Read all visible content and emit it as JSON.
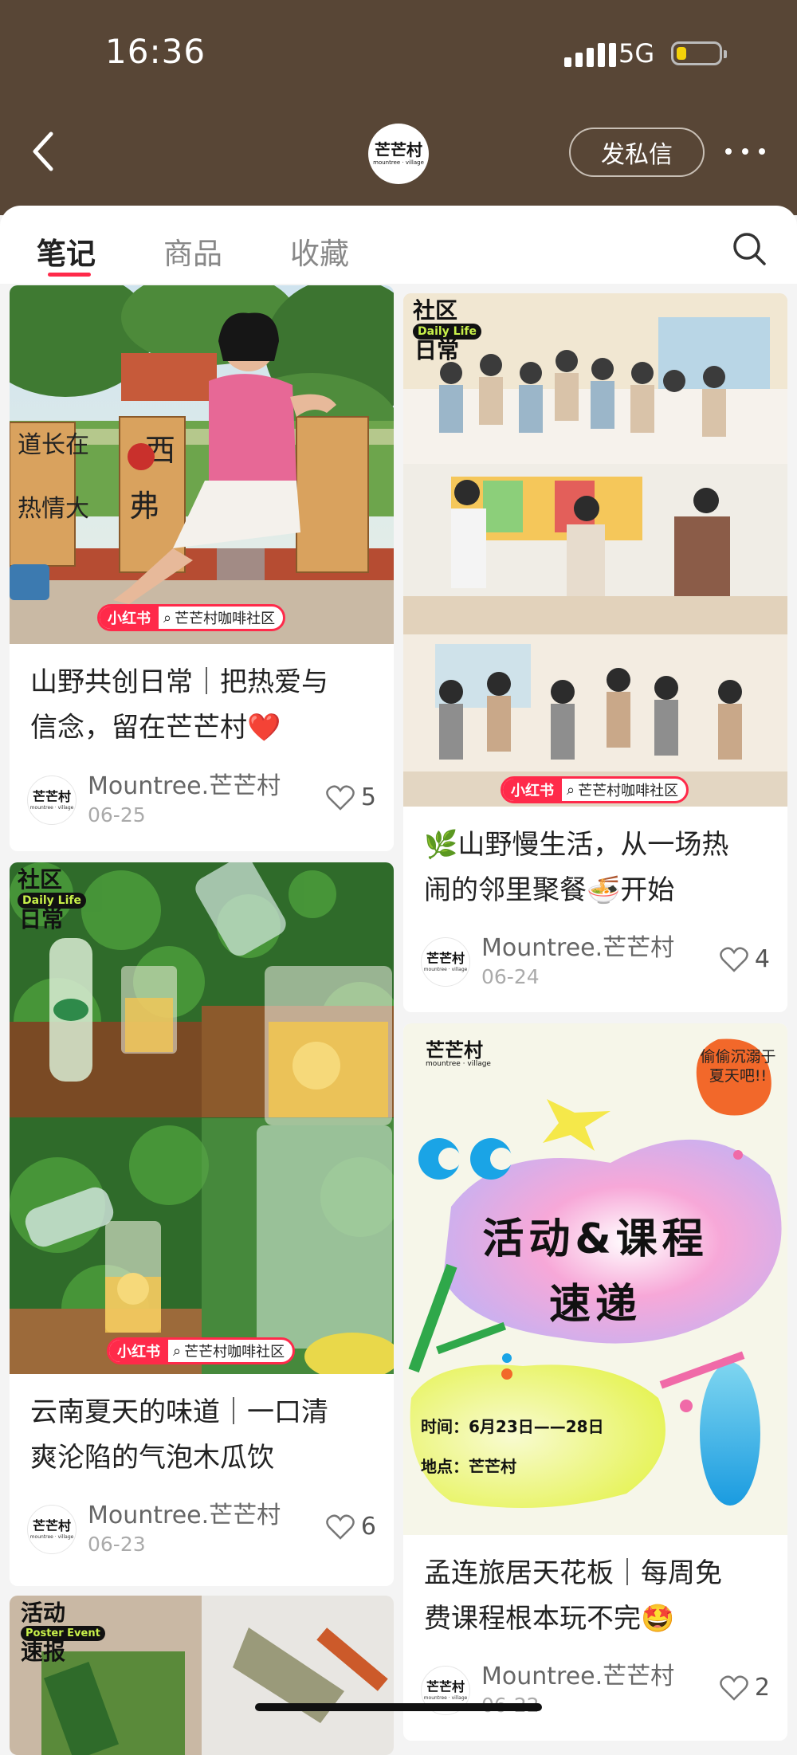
{
  "status": {
    "time": "16:36",
    "network": "5G"
  },
  "header": {
    "logo_title": "芒芒村",
    "logo_sub": "mountree · village",
    "dm_label": "发私信"
  },
  "tabs": [
    {
      "label": "笔记",
      "active": true
    },
    {
      "label": "商品",
      "active": false
    },
    {
      "label": "收藏",
      "active": false
    }
  ],
  "badge": {
    "red": "小红书",
    "search": "芒芒村咖啡社区"
  },
  "notes": [
    {
      "title_line1": "山野共创日常｜把热爱与",
      "title_line2": "信念，留在芒芒村❤️",
      "author": "Mountree.芒芒村",
      "date": "06-25",
      "likes": "5"
    },
    {
      "title_line1": "🌿山野慢生活，从一场热",
      "title_line2": "闹的邻里聚餐🍜开始",
      "author": "Mountree.芒芒村",
      "date": "06-24",
      "likes": "4"
    },
    {
      "title_line1": "云南夏天的味道｜一口清",
      "title_line2": "爽沦陷的气泡木瓜饮",
      "author": "Mountree.芒芒村",
      "date": "06-23",
      "likes": "6"
    },
    {
      "title_line1": "孟连旅居天花板｜每周免",
      "title_line2": "费课程根本玩不完🤩",
      "author": "Mountree.芒芒村",
      "date": "06-22",
      "likes": "2"
    }
  ],
  "poster_texts": {
    "community_top": "社区",
    "community_daily": "Daily Life",
    "community_cn": "日常",
    "activity_top": "活动",
    "activity_en": "Poster Event",
    "activity_cn": "速报",
    "corner_badge": "偷偷沉溺于夏天吧!!",
    "headline_1": "活动&课程",
    "headline_2": "速递",
    "time": "时间：6月23日——28日",
    "place": "地点：芒芒村",
    "brand": "芒芒村",
    "brand_sub": "mountree · village",
    "sign_1": "道长在",
    "sign_2": "热情大",
    "sign_3": "西",
    "sign_4": "弗"
  },
  "colors": {
    "header_bg": "#584636",
    "accent_red": "#ff2a4a",
    "page_bg": "#f4f4f4"
  }
}
